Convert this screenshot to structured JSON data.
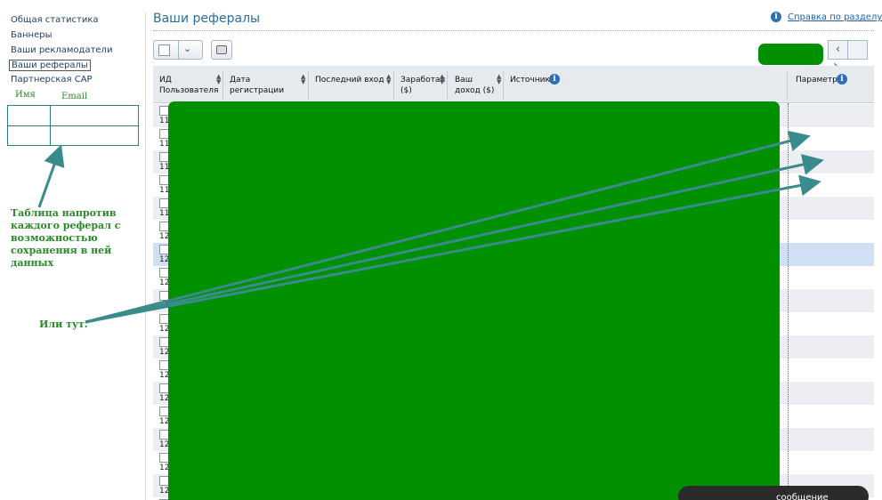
{
  "sidebar": {
    "items": [
      {
        "label": "Общая статистика",
        "active": false
      },
      {
        "label": "Баннеры",
        "active": false
      },
      {
        "label": "Ваши рекламодатели",
        "active": false
      },
      {
        "label": "Ваши рефералы",
        "active": true
      },
      {
        "label": "Партнерская CAP",
        "active": false
      }
    ]
  },
  "annotations": {
    "col_name": "Имя",
    "col_email": "Email",
    "note": "Таблица напротив каждого реферал с возможностью сохранения в ней данных",
    "alt": "Или тут.",
    "color": "#2a8a2a",
    "arrow_color": "#3a8c8c"
  },
  "header": {
    "title": "Ваши рефералы",
    "help_link": "Справка по разделу"
  },
  "toolbar": {
    "select_chevron": "⌄",
    "pager_prev": "‹",
    "pager_next": "›"
  },
  "table": {
    "columns": {
      "user_id": "ИД Пользователя",
      "registered": "Дата регистрации",
      "last_login": "Последний вход",
      "earned": "Заработал ($)",
      "your_income": "Ваш доход ($)",
      "source": "Источник",
      "parameter": "Параметр"
    },
    "row_ids": [
      "11",
      "11",
      "11",
      "11",
      "11",
      "12",
      "12",
      "12",
      "12",
      "12",
      "12",
      "12",
      "12",
      "12",
      "12",
      "12",
      "12",
      "12"
    ],
    "highlight_row": 6,
    "stripe_color": "#eceef3",
    "highlight_color": "#cfe0f5"
  },
  "overlay": {
    "mask_color": "#009000",
    "chat_label": "сообщение"
  }
}
